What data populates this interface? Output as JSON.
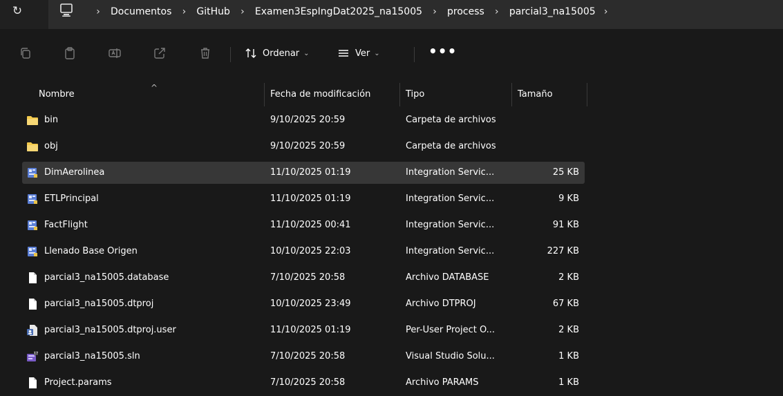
{
  "address_bar": {
    "refresh_glyph": "↻",
    "breadcrumbs": [
      "Documentos",
      "GitHub",
      "Examen3EspIngDat2025_na15005",
      "process",
      "parcial3_na15005"
    ],
    "separator": "›"
  },
  "toolbar": {
    "icons": [
      "copy-icon",
      "paste-icon",
      "rename-icon",
      "share-icon",
      "delete-icon"
    ],
    "sort_label": "Ordenar",
    "view_label": "Ver",
    "more_label": "•••"
  },
  "columns": {
    "name": "Nombre",
    "date": "Fecha de modificación",
    "type": "Tipo",
    "size": "Tamaño"
  },
  "files": [
    {
      "name": "bin",
      "date": "9/10/2025 20:59",
      "type": "Carpeta de archivos",
      "size": "",
      "icon": "folder-icon",
      "selected": false
    },
    {
      "name": "obj",
      "date": "9/10/2025 20:59",
      "type": "Carpeta de archivos",
      "size": "",
      "icon": "folder-icon",
      "selected": false
    },
    {
      "name": "DimAerolinea",
      "date": "11/10/2025 01:19",
      "type": "Integration Servic...",
      "size": "25 KB",
      "icon": "ssis-package-icon",
      "selected": true
    },
    {
      "name": "ETLPrincipal",
      "date": "11/10/2025 01:19",
      "type": "Integration Servic...",
      "size": "9 KB",
      "icon": "ssis-package-icon",
      "selected": false
    },
    {
      "name": "FactFlight",
      "date": "11/10/2025 00:41",
      "type": "Integration Servic...",
      "size": "91 KB",
      "icon": "ssis-package-icon",
      "selected": false
    },
    {
      "name": "Llenado Base Origen",
      "date": "10/10/2025 22:03",
      "type": "Integration Servic...",
      "size": "227 KB",
      "icon": "ssis-package-icon",
      "selected": false
    },
    {
      "name": "parcial3_na15005.database",
      "date": "7/10/2025 20:58",
      "type": "Archivo DATABASE",
      "size": "2 KB",
      "icon": "file-icon",
      "selected": false
    },
    {
      "name": "parcial3_na15005.dtproj",
      "date": "10/10/2025 23:49",
      "type": "Archivo DTPROJ",
      "size": "67 KB",
      "icon": "file-icon",
      "selected": false
    },
    {
      "name": "parcial3_na15005.dtproj.user",
      "date": "11/10/2025 01:19",
      "type": "Per-User Project O...",
      "size": "2 KB",
      "icon": "user-project-file-icon",
      "selected": false
    },
    {
      "name": "parcial3_na15005.sln",
      "date": "7/10/2025 20:58",
      "type": "Visual Studio Solu...",
      "size": "1 KB",
      "icon": "visual-studio-solution-icon",
      "selected": false
    },
    {
      "name": "Project.params",
      "date": "7/10/2025 20:58",
      "type": "Archivo PARAMS",
      "size": "1 KB",
      "icon": "file-icon",
      "selected": false
    }
  ],
  "colors": {
    "background": "#191919",
    "address_bar": "#2c2c2c",
    "selected_row": "#373737",
    "folder": "#f2c94c"
  }
}
